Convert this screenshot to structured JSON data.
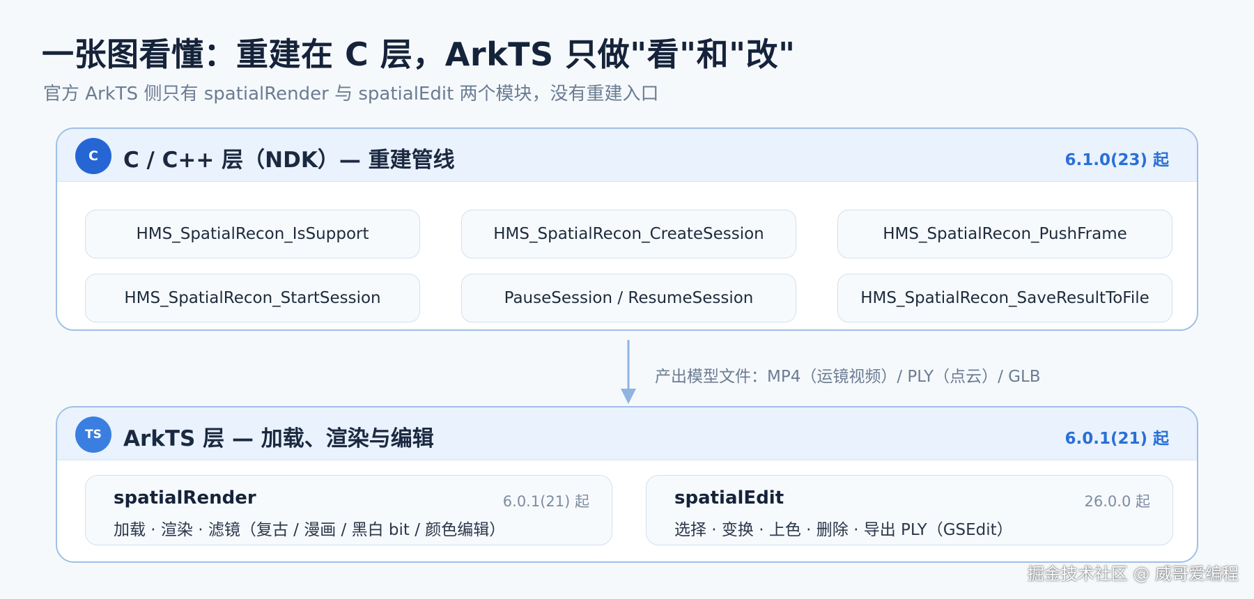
{
  "title": "一张图看懂：重建在 C 层，ArkTS 只做\"看\"和\"改\"",
  "subtitle": "官方 ArkTS 侧只有 spatialRender 与 spatialEdit 两个模块，没有重建入口",
  "c_layer": {
    "badge": "C",
    "title": "C / C++ 层（NDK）— 重建管线",
    "version": "6.1.0(23) 起",
    "apis": [
      "HMS_SpatialRecon_IsSupport",
      "HMS_SpatialRecon_CreateSession",
      "HMS_SpatialRecon_PushFrame",
      "HMS_SpatialRecon_StartSession",
      "PauseSession / ResumeSession",
      "HMS_SpatialRecon_SaveResultToFile"
    ]
  },
  "flow_label": "产出模型文件：MP4（运镜视频）/ PLY（点云）/ GLB",
  "ts_layer": {
    "badge": "TS",
    "title": "ArkTS 层 — 加载、渲染与编辑",
    "version": "6.0.1(21) 起",
    "modules": [
      {
        "name": "spatialRender",
        "version": "6.0.1(21) 起",
        "desc": "加载 · 渲染 · 滤镜（复古 / 漫画 / 黑白 bit / 颜色编辑）"
      },
      {
        "name": "spatialEdit",
        "version": "26.0.0 起",
        "desc": "选择 · 变换 · 上色 · 删除 · 导出 PLY（GSEdit）"
      }
    ]
  },
  "watermark": "掘金技术社区 @ 威哥爱编程",
  "colors": {
    "accent": "#2566d4",
    "panel_border": "#9fbfe6",
    "arrow": "#8fb4e0"
  }
}
